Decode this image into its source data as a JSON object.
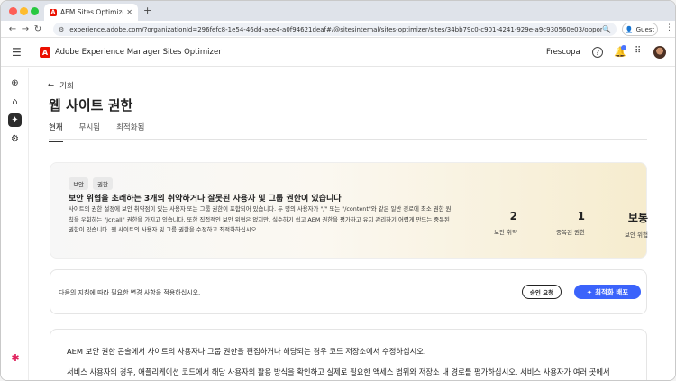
{
  "browser": {
    "tab_title": "AEM Sites Optimizer | Adob",
    "new_tab": "+",
    "url": "experience.adobe.com/?organizationId=296fefc8-1e54-46dd-aee4-a0f94621deaf#/@sitesinternal/sites-optimizer/sites/34bb79c0-c901-4241-929e-a9c930560e03/opportunities/fe2a5b2b...",
    "profile_label": "Guest"
  },
  "header": {
    "app_title": "Adobe Experience Manager Sites Optimizer",
    "org_name": "Frescopa"
  },
  "page": {
    "back_label": "기회",
    "title": "웹 사이트 권한",
    "tabs": [
      {
        "label": "현재"
      },
      {
        "label": "무시됨"
      },
      {
        "label": "최적화됨"
      }
    ]
  },
  "summary": {
    "chips": [
      "보안",
      "권한"
    ],
    "title": "보안 위협을 초래하는 3개의 취약하거나 잘못된 사용자 및 그룹 권한이 있습니다",
    "description": "사이트의 권한 설정에 보안 취약점이 있는 사용자 또는 그룹 권한이 포함되어 있습니다. 두 명의 사용자가 \"/\" 또는 \"/content\"와 같은 일반 경로에 최소 권한 원칙을 우회하는 \"jcr:all\" 권한을 가지고 있습니다. 또한 직접적인 보안 위협은 없지만, 실수하기 쉽고 AEM 권한을 평가하고 유지 관리하기 어렵게 만드는 중복된 권한이 있습니다. 웹 사이트의 사용자 및 그룹 권한을 수정하고 최적화하십시오.",
    "metrics": [
      {
        "value": "2",
        "label": "보안 취약"
      },
      {
        "value": "1",
        "label": "중복된 권한"
      },
      {
        "value": "보통",
        "label": "보안 위험"
      }
    ]
  },
  "action": {
    "instruction": "다음의 지침에 따라 필요한 변경 사항을 적용하십시오.",
    "approve_label": "승인 요청",
    "deploy_label": "최적화 배포"
  },
  "detail": {
    "p1": "AEM 보안 권한 콘솔에서 사이트의 사용자나 그룹 권한을 편집하거나 해당되는 경우 코드 저장소에서 수정하십시오.",
    "p2": "서비스 사용자의 경우, 애플리케이션 코드에서 해당 사용자의 활용 방식을 확인하고 실제로 필요한 액세스 범위와 저장소 내 경로를 평가하십시오. 서비스 사용자가 여러 곳에서"
  },
  "colors": {
    "accent": "#3b63fb",
    "brand": "#eb1000"
  }
}
